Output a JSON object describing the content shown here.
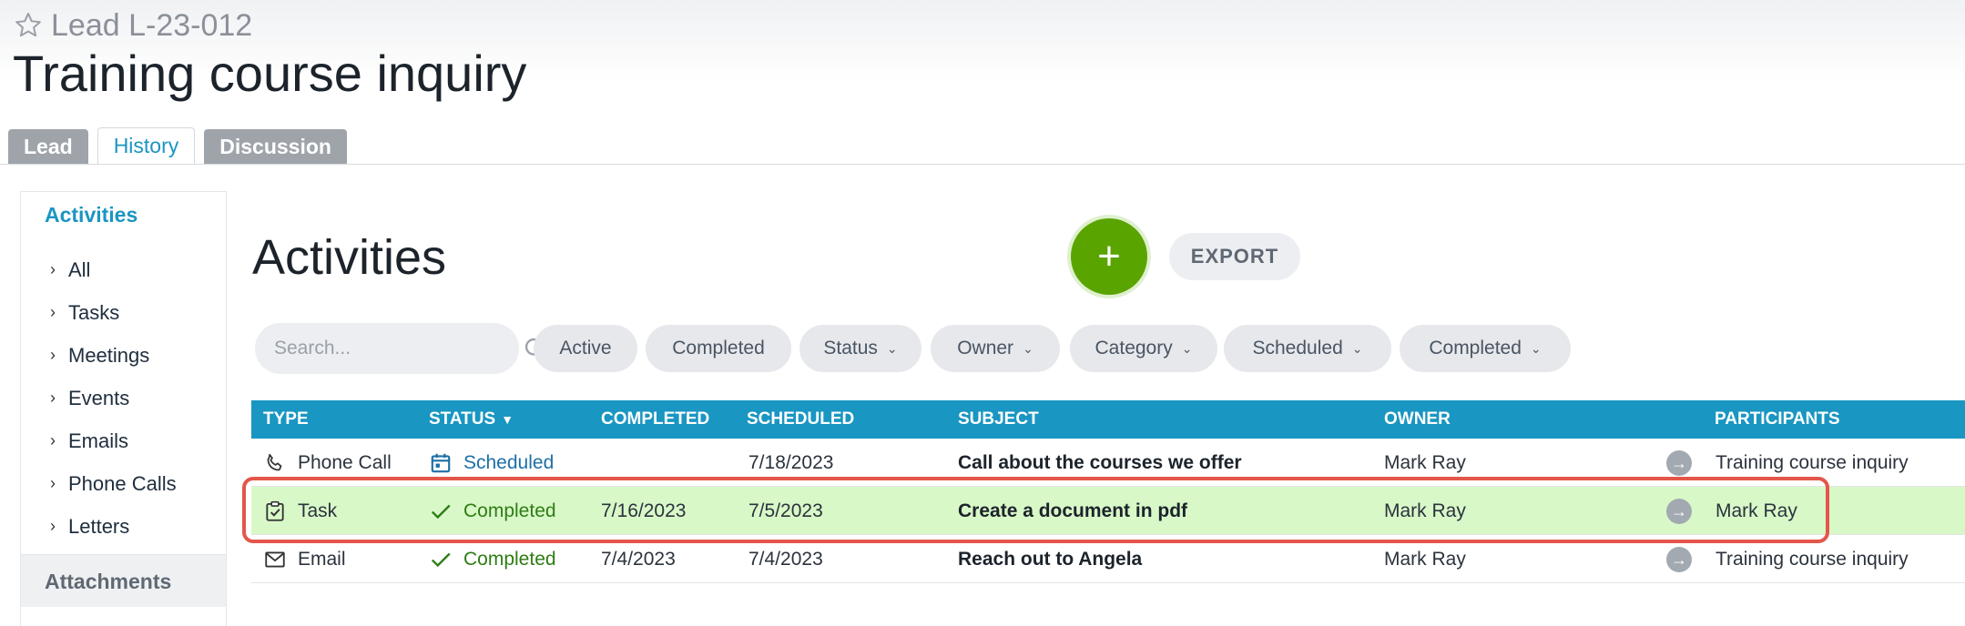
{
  "header": {
    "lead_id": "Lead L-23-012",
    "title": "Training course inquiry"
  },
  "tabs": [
    {
      "label": "Lead"
    },
    {
      "label": "History"
    },
    {
      "label": "Discussion"
    }
  ],
  "sidebar": {
    "heading": "Activities",
    "items": [
      {
        "label": "All"
      },
      {
        "label": "Tasks"
      },
      {
        "label": "Meetings"
      },
      {
        "label": "Events"
      },
      {
        "label": "Emails"
      },
      {
        "label": "Phone Calls"
      },
      {
        "label": "Letters"
      }
    ],
    "attachments": "Attachments"
  },
  "main": {
    "title": "Activities",
    "add_label": "+",
    "export_label": "EXPORT",
    "search_placeholder": "Search...",
    "filters": [
      {
        "label": "Active"
      },
      {
        "label": "Completed"
      },
      {
        "label": "Status"
      },
      {
        "label": "Owner"
      },
      {
        "label": "Category"
      },
      {
        "label": "Scheduled"
      },
      {
        "label": "Completed"
      }
    ]
  },
  "table": {
    "columns": [
      "TYPE",
      "STATUS",
      "COMPLETED",
      "SCHEDULED",
      "SUBJECT",
      "OWNER",
      "PARTICIPANTS"
    ],
    "rows": [
      {
        "type": "Phone Call",
        "type_icon": "phone-icon",
        "status": "Scheduled",
        "status_icon": "calendar-icon",
        "completed": "",
        "scheduled": "7/18/2023",
        "subject": "Call about the courses we offer",
        "owner": "Mark Ray",
        "participants": "Training course inquiry"
      },
      {
        "type": "Task",
        "type_icon": "task-icon",
        "status": "Completed",
        "status_icon": "check-icon",
        "completed": "7/16/2023",
        "scheduled": "7/5/2023",
        "subject": "Create a document in pdf",
        "owner": "Mark Ray",
        "participants": "Mark Ray"
      },
      {
        "type": "Email",
        "type_icon": "email-icon",
        "status": "Completed",
        "status_icon": "check-icon",
        "completed": "7/4/2023",
        "scheduled": "7/4/2023",
        "subject": "Reach out to Angela",
        "owner": "Mark Ray",
        "participants": "Training course inquiry"
      }
    ]
  },
  "colors": {
    "accent": "#1996c2",
    "add_button": "#5aa400",
    "highlight_row": "#d9f8c8",
    "highlight_border": "#e4564a",
    "completed_status": "#2d7d14",
    "scheduled_status": "#1d6fa5"
  }
}
